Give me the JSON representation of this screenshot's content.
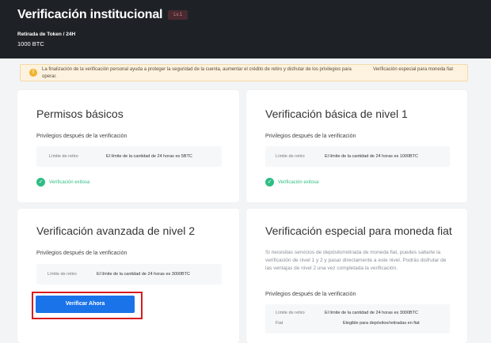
{
  "header": {
    "title": "Verificación institucional",
    "level_badge": "Lv.1",
    "limit_label": "Retirada de Token / 24H",
    "limit_value": "1000 BTC"
  },
  "notice": {
    "icon": "info-icon",
    "text": "La finalización de la verificación personal ayuda a proteger la seguridad de la cuenta, aumentar el crédito de retiro y disfrutar de los privilegios para operar.",
    "link": "Verificación especial para moneda fiat"
  },
  "cards": {
    "basic_permissions": {
      "title": "Permisos básicos",
      "subtitle": "Privilegios después de la verificación",
      "limit_label": "Límite de retiro",
      "limit_value": "El límite de la cantidad de 24 horas es 5BTC",
      "status": "Verificación exitosa"
    },
    "basic_level1": {
      "title": "Verificación básica de nivel 1",
      "subtitle": "Privilegios después de la verificación",
      "limit_label": "Límite de retiro",
      "limit_value": "El límite de la cantidad de 24 horas es 1000BTC",
      "status": "Verificación exitosa"
    },
    "advanced_level2": {
      "title": "Verificación avanzada de nivel 2",
      "subtitle": "Privilegios después de la verificación",
      "limit_label": "Límite de retiro",
      "limit_value": "El límite de la cantidad de 24 horas es 3000BTC",
      "button": "Verificar Ahora"
    },
    "fiat_special": {
      "title": "Verificación especial para moneda fiat",
      "description": "Si necesitas servicios de depósito/retirada de moneda fiat, puedes saltarte la verificación de nivel 1 y 2 y pasar directamente a este nivel. Podrás disfrutar de las ventajas de nivel 2 una vez completada la verificación.",
      "subtitle": "Privilegios después de la verificación",
      "limit_label": "Límite de retiro",
      "limit_value": "El límite de la cantidad de 24 horas es 3000BTC",
      "fiat_label": "Fiat",
      "fiat_value": "Elegible para depósitos/retiradas en fiat"
    }
  },
  "colors": {
    "header_bg": "#1e2227",
    "accent": "#1a73e8",
    "success": "#2ebd85",
    "highlight": "#d81c20"
  }
}
